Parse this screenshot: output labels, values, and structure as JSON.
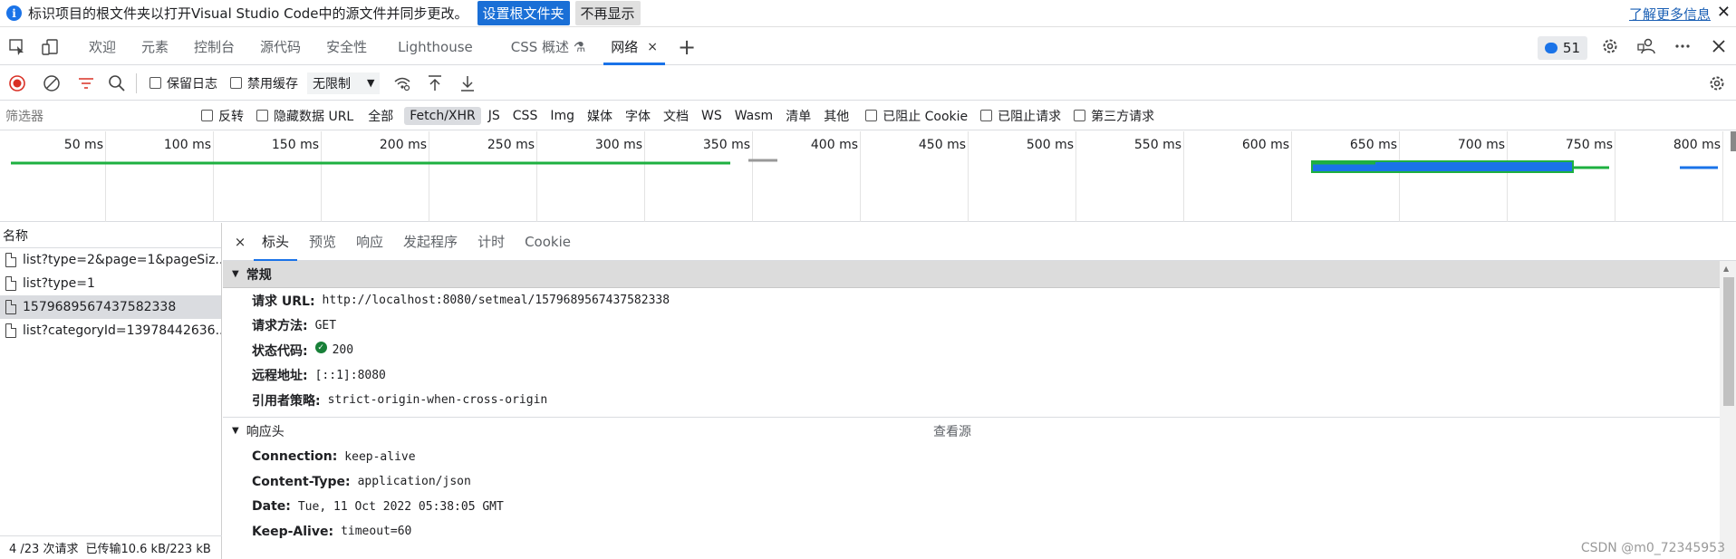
{
  "infobar": {
    "info_icon": "info-icon",
    "message": "标识项目的根文件夹以打开Visual Studio Code中的源文件并同步更改。",
    "primary_button": "设置根文件夹",
    "secondary_button": "不再显示",
    "learn_more": "了解更多信息",
    "close_glyph": "✕"
  },
  "tabs": {
    "items": [
      "欢迎",
      "元素",
      "控制台",
      "源代码",
      "安全性",
      "Lighthouse",
      "CSS 概述 ⚗",
      "网络"
    ],
    "active_index": 7,
    "issues_count": "51",
    "close_glyph": "×",
    "plus_glyph": "+"
  },
  "toolbar": {
    "preserve_log": "保留日志",
    "disable_cache": "禁用缓存",
    "throttle": "无限制"
  },
  "filterbar": {
    "placeholder": "筛选器",
    "invert": "反转",
    "hide_data_urls": "隐藏数据 URL",
    "types": [
      "全部",
      "Fetch/XHR",
      "JS",
      "CSS",
      "Img",
      "媒体",
      "字体",
      "文档",
      "WS",
      "Wasm",
      "清单",
      "其他"
    ],
    "active_type": "Fetch/XHR",
    "blocked_cookies": "已阻止 Cookie",
    "blocked_requests": "已阻止请求",
    "third_party": "第三方请求"
  },
  "overview": {
    "ticks": [
      "50 ms",
      "100 ms",
      "150 ms",
      "200 ms",
      "250 ms",
      "300 ms",
      "350 ms",
      "400 ms",
      "450 ms",
      "500 ms",
      "550 ms",
      "600 ms",
      "650 ms",
      "700 ms",
      "750 ms",
      "800 ms"
    ]
  },
  "requests": {
    "header": "名称",
    "items": [
      "list?type=2&page=1&pageSiz...",
      "list?type=1",
      "1579689567437582338",
      "list?categoryId=13978442636..."
    ],
    "selected_index": 2,
    "status_count": "4 /23 次请求",
    "status_transfer": "已传输10.6 kB/223 kB"
  },
  "detail": {
    "close_glyph": "×",
    "tabs": [
      "标头",
      "预览",
      "响应",
      "发起程序",
      "计时",
      "Cookie"
    ],
    "active_tab": "标头",
    "general": {
      "title": "常规",
      "rows": [
        {
          "k": "请求 URL:",
          "v": "http://localhost:8080/setmeal/1579689567437582338"
        },
        {
          "k": "请求方法:",
          "v": "GET"
        },
        {
          "k": "状态代码:",
          "v": "200"
        },
        {
          "k": "远程地址:",
          "v": "[::1]:8080"
        },
        {
          "k": "引用者策略:",
          "v": "strict-origin-when-cross-origin"
        }
      ]
    },
    "response_headers": {
      "title": "响应头",
      "view_source": "查看源",
      "rows": [
        {
          "k": "Connection:",
          "v": "keep-alive"
        },
        {
          "k": "Content-Type:",
          "v": "application/json"
        },
        {
          "k": "Date:",
          "v": "Tue, 11 Oct 2022 05:38:05 GMT"
        },
        {
          "k": "Keep-Alive:",
          "v": "timeout=60"
        }
      ]
    }
  },
  "watermark": "CSDN @m0_72345953",
  "colors": {
    "accent": "#1a73e8",
    "record": "#d93025",
    "status_ok": "#188038",
    "waterfall_green": "#1eb040",
    "waterfall_blue": "#1a73e8"
  }
}
